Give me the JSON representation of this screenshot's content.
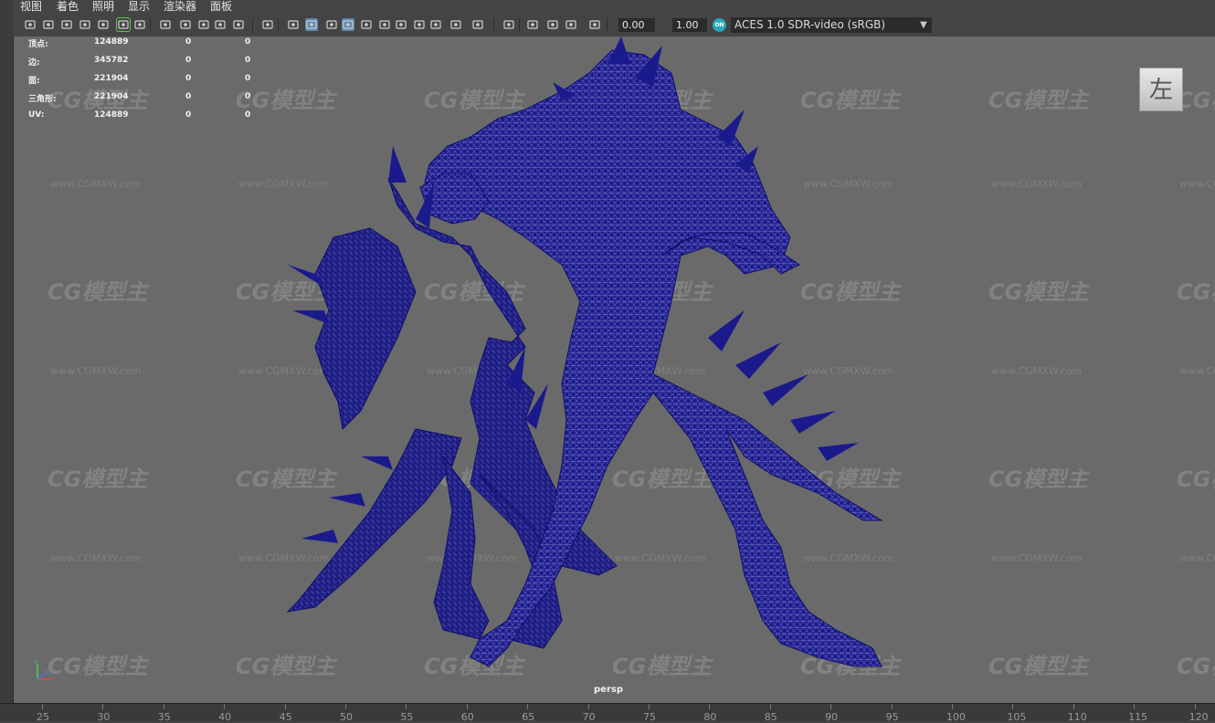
{
  "menubar": {
    "items": [
      "视图",
      "着色",
      "照明",
      "显示",
      "渲染器",
      "面板"
    ]
  },
  "toolbar": {
    "exposure_value": "0.00",
    "gamma_value": "1.00",
    "color_management_label": "ON",
    "color_transform": "ACES 1.0 SDR-video (sRGB)",
    "icons": [
      "select-camera-icon",
      "camera-attributes-icon",
      "bookmark-icon",
      "image-plane-icon",
      "2d-pan-zoom-icon",
      "grease-pencil-icon",
      "grid-icon",
      "film-gate-icon",
      "resolution-gate-icon",
      "gate-mask-icon",
      "field-chart-icon",
      "safe-action-icon",
      "safe-title-icon",
      "wireframe-icon",
      "smooth-shade-icon",
      "default-material-icon",
      "wireframe-on-shaded-icon",
      "textured-icon",
      "use-all-lights-icon",
      "shadows-icon",
      "screen-space-ao-icon",
      "motion-blur-icon",
      "anti-aliasing-icon",
      "depth-of-field-icon",
      "isolate-select-icon",
      "xray-icon",
      "xray-joints-icon",
      "backface-culling-icon",
      "exposure-icon",
      "gamma-icon",
      "color-management-icon"
    ]
  },
  "hud": {
    "rows": [
      {
        "label": "顶点:",
        "value": "124889",
        "col2": "0",
        "col3": "0"
      },
      {
        "label": "边:",
        "value": "345782",
        "col2": "0",
        "col3": "0"
      },
      {
        "label": "面:",
        "value": "221904",
        "col2": "0",
        "col3": "0"
      },
      {
        "label": "三角形:",
        "value": "221904",
        "col2": "0",
        "col3": "0"
      },
      {
        "label": "UV:",
        "value": "124889",
        "col2": "0",
        "col3": "0"
      }
    ]
  },
  "viewport": {
    "view_cube_label": "左",
    "camera_name": "persp",
    "watermark_text": "CG模型主",
    "watermark_url": "www.CGMXW.com",
    "mesh_color": "#141485",
    "background_color": "#6a6a6a"
  },
  "timeline": {
    "ticks": [
      "25",
      "30",
      "35",
      "40",
      "45",
      "50",
      "55",
      "60",
      "65",
      "70",
      "75",
      "80",
      "85",
      "90",
      "95",
      "100",
      "105",
      "110",
      "115",
      "120"
    ]
  },
  "axis_gizmo": {
    "x": "x",
    "y": "y",
    "z": "z"
  }
}
